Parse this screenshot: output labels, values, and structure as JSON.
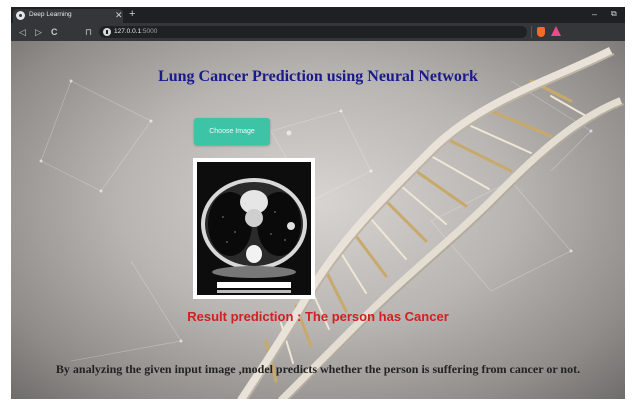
{
  "browser": {
    "tab_title": "Deep Learning",
    "tab_close": "✕",
    "new_tab": "+",
    "url_host": "127.0.0.1",
    "url_port": ":5000",
    "back_icon": "◁",
    "forward_icon": "▷",
    "reload_icon": "C",
    "bookmark_icon": "⊓",
    "minimize_icon": "–",
    "restore_icon": "⧉"
  },
  "page": {
    "title": "Lung Cancer Prediction using Neural Network",
    "choose_button": "Choose Image",
    "result_text": "Result prediction : The person has Cancer",
    "description": "By analyzing the given input image ,model predicts whether the person is suffering from cancer or not."
  },
  "colors": {
    "title": "#1a1a8c",
    "button": "#3dc3a6",
    "result": "#d22020"
  }
}
